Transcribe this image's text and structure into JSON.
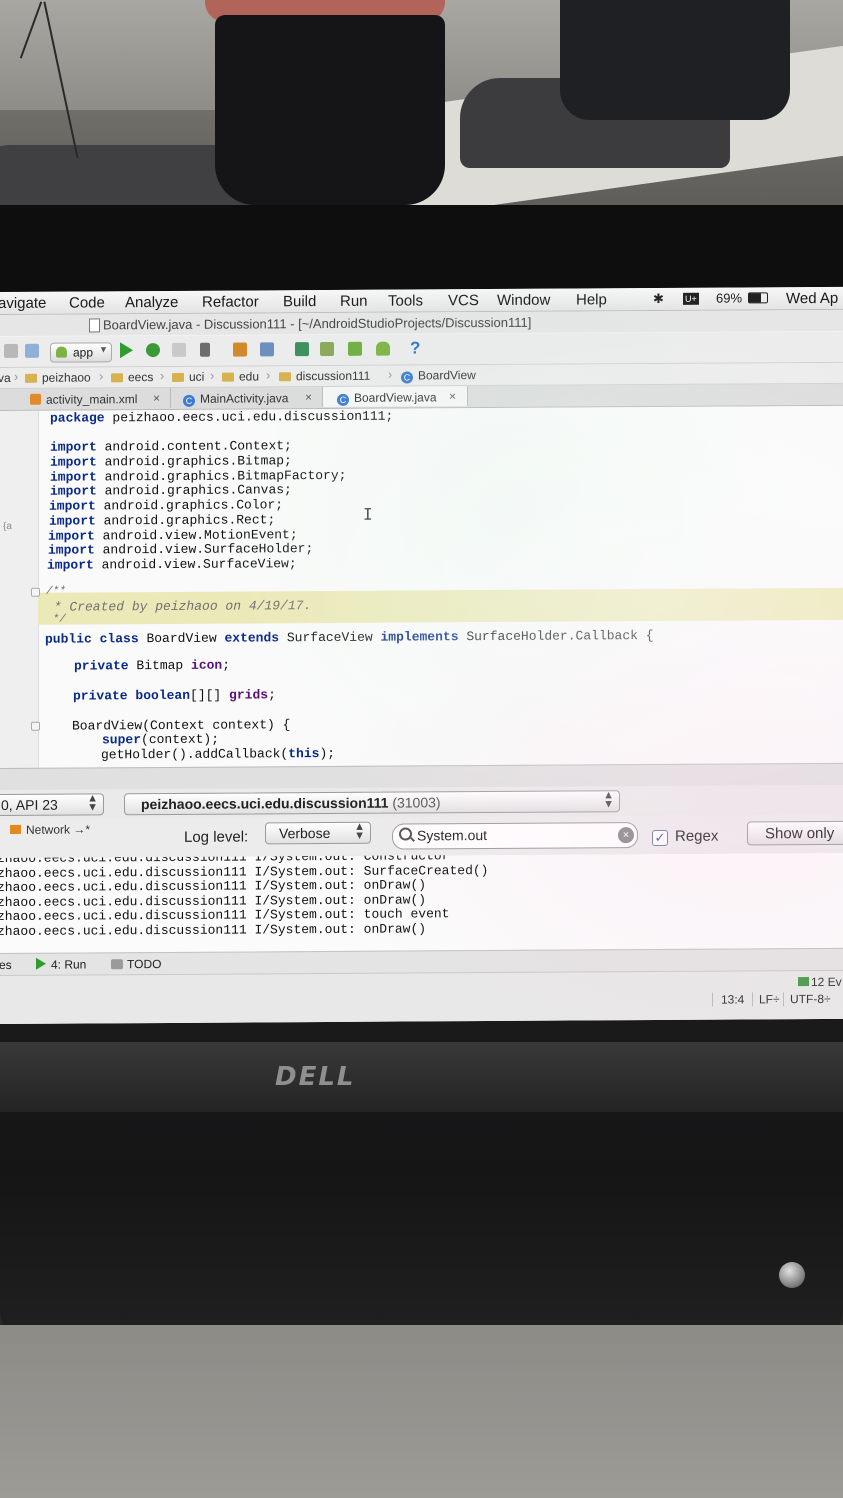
{
  "menubar": {
    "items": [
      "avigate",
      "Code",
      "Analyze",
      "Refactor",
      "Build",
      "Run",
      "Tools",
      "VCS",
      "Window",
      "Help"
    ],
    "status": {
      "bluetooth_icon": "bluetooth-icon",
      "input_icon": "u-plus",
      "battery": "69%",
      "datetime": "Wed Ap"
    }
  },
  "window": {
    "title": "BoardView.java - Discussion111 - [~/AndroidStudioProjects/Discussion111]"
  },
  "toolbar": {
    "run_config": "app",
    "help_glyph": "?"
  },
  "breadcrumb": {
    "lead": "va",
    "items": [
      "peizhaoo",
      "eecs",
      "uci",
      "edu",
      "discussion111",
      "BoardView"
    ]
  },
  "tabs": [
    {
      "label": "activity_main.xml",
      "close": "×"
    },
    {
      "label": "MainActivity.java",
      "close": "×"
    },
    {
      "label": "BoardView.java",
      "close": "×",
      "active": true
    }
  ],
  "editor": {
    "package_kw": "package",
    "package_name": " peizhaoo.eecs.uci.edu.discussion111;",
    "imports": [
      "android.content.Context;",
      "android.graphics.Bitmap;",
      "android.graphics.BitmapFactory;",
      "android.graphics.Canvas;",
      "android.graphics.Color;",
      "android.graphics.Rect;",
      "android.view.MotionEvent;",
      "android.view.SurfaceHolder;",
      "android.view.SurfaceView;"
    ],
    "import_kw": "import",
    "comment": [
      "/**",
      " * Created by peizhaoo on 4/19/17.",
      " */"
    ],
    "class_decl": {
      "kw1": "public",
      "kw2": "class",
      "name": " BoardView ",
      "kw3": "extends",
      "parent": " SurfaceView ",
      "kw4": "implements",
      "iface": " SurfaceHolder.Callback {"
    },
    "field1": {
      "kw": "private",
      "type": " Bitmap ",
      "name": "icon",
      "end": ";"
    },
    "field2": {
      "kw1": "private",
      "kw2": "boolean",
      "type": "[][] ",
      "name": "grids",
      "end": ";"
    },
    "ctor": "BoardView(Context context) {",
    "super_kw": "super",
    "super_rest": "(context);",
    "holder": "getHolder().addCallback(",
    "this_kw": "this",
    "holder_end": ");",
    "gutter_marker": "{a"
  },
  "device": {
    "selector": "0, API 23",
    "process_pkg": "peizhaoo.eecs.uci.edu.discussion111",
    "process_pid": " (31003)"
  },
  "logcat": {
    "network_tab": "Network",
    "network_arrow": "→*",
    "log_level_label": "Log level:",
    "log_level_value": "Verbose",
    "filter_value": "System.out",
    "regex_label": "Regex",
    "regex_checked": true,
    "show_only": "Show only",
    "lines": [
      "zhaoo.eecs.uci.edu.discussion111 I/System.out: Constructor",
      "zhaoo.eecs.uci.edu.discussion111 I/System.out: SurfaceCreated()",
      "zhaoo.eecs.uci.edu.discussion111 I/System.out: onDraw()",
      "zhaoo.eecs.uci.edu.discussion111 I/System.out: onDraw()",
      "zhaoo.eecs.uci.edu.discussion111 I/System.out: touch event",
      "zhaoo.eecs.uci.edu.discussion111 I/System.out: onDraw()"
    ]
  },
  "bottom_tools": {
    "lead": "es",
    "run": "4: Run",
    "todo": "TODO"
  },
  "statusbar": {
    "events": "12 Ev",
    "position": "13:4",
    "line_sep": "LF÷",
    "encoding": "UTF-8÷"
  },
  "monitor": {
    "brand": "DELL"
  },
  "colors": {
    "keyword": "#0a2a8a",
    "comment_bg": "#ece9b8",
    "run_green": "#2e9d2e",
    "accent_blue": "#3d7bcf"
  }
}
